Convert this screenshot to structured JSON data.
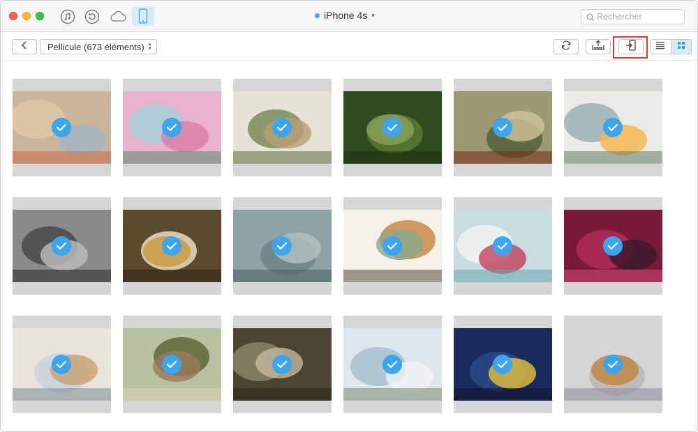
{
  "titlebar": {
    "device_name": "iPhone 4s",
    "search_placeholder": "Rechercher",
    "icons": [
      "music-icon",
      "restore-icon",
      "cloud-icon",
      "phone-icon"
    ]
  },
  "toolbar": {
    "album_label": "Pellicule (673 éléments)",
    "buttons": [
      "back-icon",
      "refresh-icon",
      "export-to-computer-icon",
      "import-to-device-icon",
      "list-view-icon",
      "grid-view-icon"
    ],
    "active_view": "grid"
  },
  "colors": {
    "accent": "#3ba6ed",
    "highlight": "#e8362b",
    "tile_bg": "#d6d6d6"
  },
  "photos": [
    {
      "name": "photo-1",
      "selected": true,
      "palette": [
        "#c9b59a",
        "#e0c7a6",
        "#9fb7c5",
        "#c86a4a"
      ]
    },
    {
      "name": "photo-2",
      "selected": true,
      "palette": [
        "#e9b3cf",
        "#a7cfd6",
        "#d97aa8",
        "#5a8a6a"
      ]
    },
    {
      "name": "photo-3",
      "selected": true,
      "palette": [
        "#e6e2d6",
        "#7c8a5a",
        "#b8a070",
        "#5f6f3f"
      ]
    },
    {
      "name": "photo-4",
      "selected": true,
      "palette": [
        "#2f4a1e",
        "#5a7a32",
        "#8aa35a",
        "#1f3212"
      ]
    },
    {
      "name": "photo-5",
      "selected": true,
      "palette": [
        "#9c9a72",
        "#54623c",
        "#d2c39a",
        "#7a2a1a"
      ]
    },
    {
      "name": "photo-6",
      "selected": true,
      "palette": [
        "#eceae4",
        "#9cb0b8",
        "#f2b54a",
        "#6a7a6a"
      ]
    },
    {
      "name": "photo-7",
      "selected": true,
      "palette": [
        "#8a8a8a",
        "#4a4a4a",
        "#bdbdbd",
        "#2a2a2a"
      ]
    },
    {
      "name": "photo-8",
      "selected": true,
      "palette": [
        "#5a4a2e",
        "#e7dcc2",
        "#c99a3a",
        "#2e2416"
      ]
    },
    {
      "name": "photo-9",
      "selected": true,
      "palette": [
        "#8fa3a6",
        "#6e8588",
        "#b3c2c2",
        "#4a5e60"
      ]
    },
    {
      "name": "photo-10",
      "selected": true,
      "palette": [
        "#f4f1ea",
        "#c98a4a",
        "#8aa88a",
        "#5a4a3a"
      ]
    },
    {
      "name": "photo-11",
      "selected": true,
      "palette": [
        "#c9dde0",
        "#f2f2f2",
        "#c2435a",
        "#6aa6b0"
      ]
    },
    {
      "name": "photo-12",
      "selected": true,
      "palette": [
        "#7a1a3a",
        "#b02a5a",
        "#3a1a2a",
        "#d04a7a"
      ]
    },
    {
      "name": "photo-13",
      "selected": true,
      "palette": [
        "#e8e4da",
        "#c8d4da",
        "#c8a070",
        "#7a8a9a"
      ]
    },
    {
      "name": "photo-14",
      "selected": true,
      "palette": [
        "#b8c2a0",
        "#5a6a3a",
        "#9a7a5a",
        "#d8d2b8"
      ]
    },
    {
      "name": "photo-15",
      "selected": true,
      "palette": [
        "#4a4430",
        "#8a8266",
        "#c2b89a",
        "#2a261a"
      ]
    },
    {
      "name": "photo-16",
      "selected": true,
      "palette": [
        "#dfe6ec",
        "#a8c0d0",
        "#f0f2f4",
        "#7a8a70"
      ]
    },
    {
      "name": "photo-17",
      "selected": true,
      "palette": [
        "#1a2a5a",
        "#2a4a8a",
        "#e8c23a",
        "#0e1430"
      ]
    },
    {
      "name": "photo-18",
      "selected": true,
      "palette": [
        "#d6d6d6",
        "#b8b8b8",
        "#c0843a",
        "#8a8a9a"
      ]
    }
  ]
}
